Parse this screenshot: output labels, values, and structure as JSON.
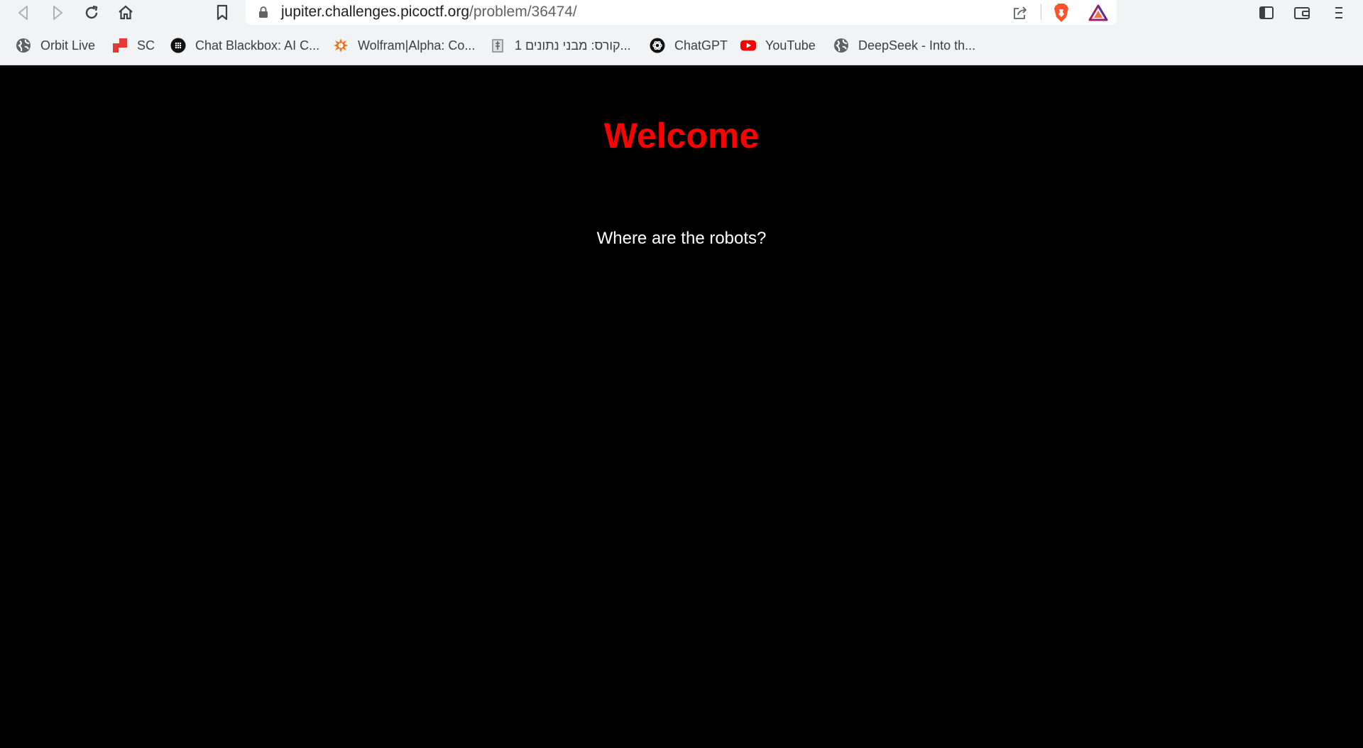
{
  "browser": {
    "url_host": "jupiter.challenges.picoctf.org",
    "url_path": "/problem/36474/",
    "toolbar_icons": [
      "back-icon",
      "forward-icon",
      "reload-icon",
      "home-icon",
      "bookmark-icon",
      "lock-icon",
      "share-icon",
      "brave-shields-icon",
      "brave-rewards-icon",
      "sidebar-icon",
      "wallet-icon",
      "menu-icon"
    ]
  },
  "bookmarks": [
    {
      "label": "Orbit Live",
      "icon": "globe-icon"
    },
    {
      "label": "SC",
      "icon": "sc-logo-icon"
    },
    {
      "label": "Chat Blackbox: AI C...",
      "icon": "blackbox-icon"
    },
    {
      "label": "Wolfram|Alpha: Co...",
      "icon": "wolfram-icon"
    },
    {
      "label": "קורס: מבני נתונים 1...",
      "icon": "course-icon"
    },
    {
      "label": "ChatGPT",
      "icon": "chatgpt-icon"
    },
    {
      "label": "YouTube",
      "icon": "youtube-icon"
    },
    {
      "label": "DeepSeek - Into th...",
      "icon": "globe-icon"
    }
  ],
  "page": {
    "heading": "Welcome",
    "text": "Where are the robots?",
    "heading_color": "#ff0000",
    "background_color": "#000000",
    "text_color": "#ffffff"
  }
}
